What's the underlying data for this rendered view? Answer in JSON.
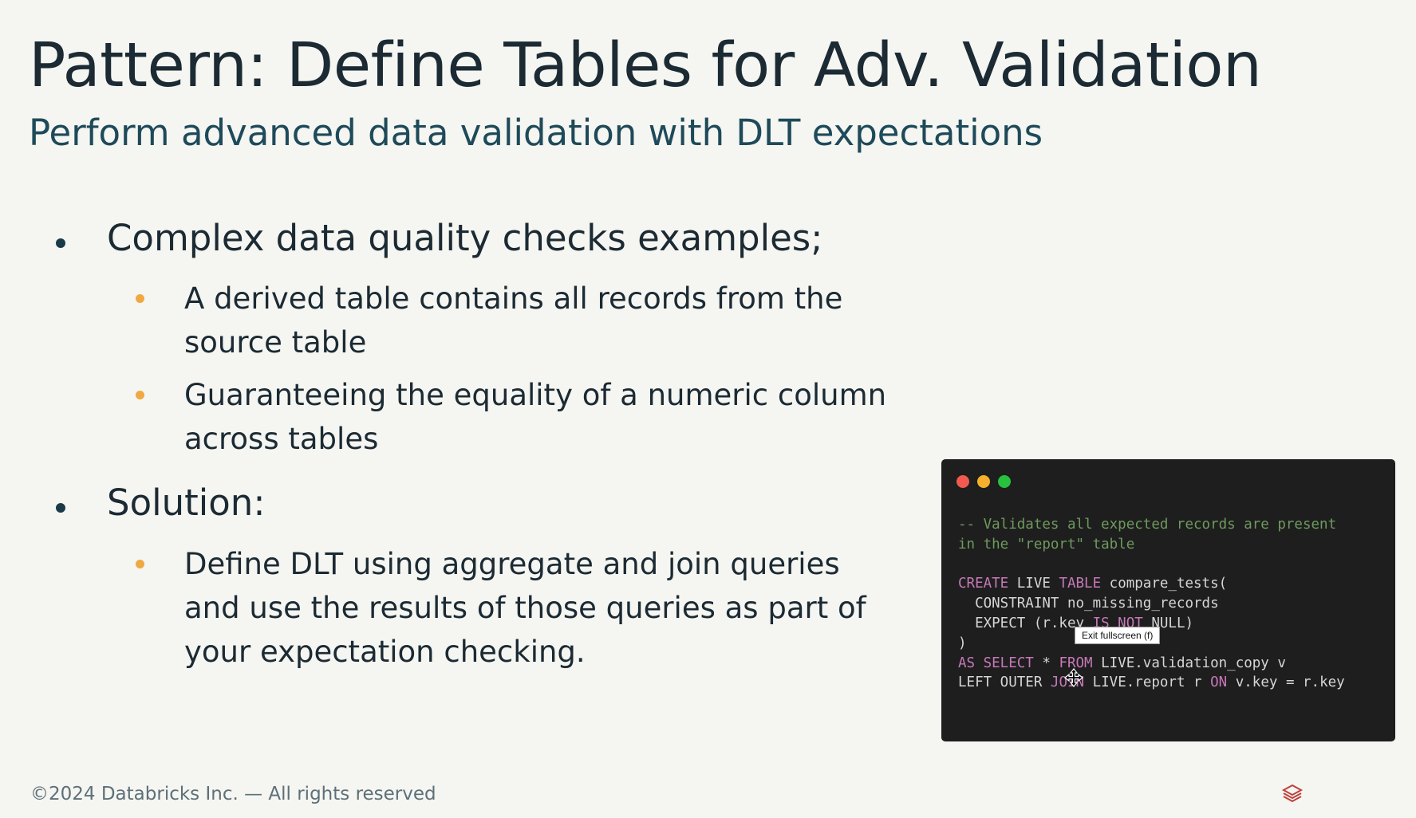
{
  "slide": {
    "title": "Pattern: Define Tables for Adv. Validation",
    "subtitle": "Perform advanced data validation with DLT expectations"
  },
  "bullets": [
    {
      "text": "Complex data quality checks examples;",
      "sub": [
        "A derived table contains all records from the source table",
        "Guaranteeing the equality of a numeric column across tables"
      ]
    },
    {
      "text": "Solution:",
      "sub": [
        "Define DLT using aggregate and join queries and use the results of those queries as part of your expectation checking."
      ]
    }
  ],
  "code_window": {
    "comment_line1": "-- Validates all expected records are present",
    "comment_line2": "in the \"report\" table",
    "l3_kw1": "CREATE",
    "l3_t1": " LIVE ",
    "l3_kw2": "TABLE",
    "l3_t2": " compare_tests(",
    "l4": "  CONSTRAINT no_missing_records",
    "l5_t1": "  EXPECT (r.key ",
    "l5_kw1": "IS NOT",
    "l5_t2": " NULL)",
    "l6": ")",
    "l7_kw1": "AS SELECT",
    "l7_t1": " * ",
    "l7_kw2": "FROM",
    "l7_t2": " LIVE.validation_copy v",
    "l8_t1": "LEFT OUTER ",
    "l8_kw1": "JOIN",
    "l8_t2": " LIVE.report r ",
    "l8_kw2": "ON",
    "l8_t3": " v.key = r.key"
  },
  "tooltip": "Exit fullscreen (f)",
  "footer": "©2024 Databricks Inc. — All rights reserved",
  "icons": {
    "logo": "databricks-logo",
    "cursor": "move-cursor"
  },
  "colors": {
    "background": "#f5f5f1",
    "title": "#1b2a33",
    "subtitle": "#1e4a5a",
    "sub_bullet": "#f0a840",
    "code_bg": "#1e1e1e",
    "code_comment": "#6e9a5e",
    "code_keyword": "#c678b8",
    "logo": "#c0403a"
  }
}
